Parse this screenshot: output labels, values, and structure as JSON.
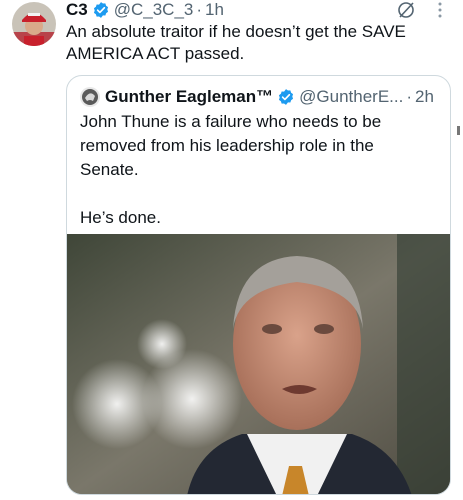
{
  "tweet": {
    "author_name": "C3",
    "handle": "@C_3C_3",
    "separator": "·",
    "time": "1h",
    "text": "An absolute traitor if he doesn’t get the SAVE AMERICA ACT passed.",
    "verified": true
  },
  "quoted_tweet": {
    "author_name": "Gunther Eagleman™",
    "handle": "@GuntherE...",
    "separator": "·",
    "time": "2h",
    "text": "John Thune is a failure who needs to be removed from his leadership role in the Senate.\n\nHe’s done.",
    "verified": true,
    "has_photo": true
  },
  "colors": {
    "verified_badge": "#1d9bf0",
    "secondary_text": "#536471",
    "border": "#cfd9de"
  },
  "icons": [
    "verified-icon",
    "grok-icon",
    "more-icon"
  ]
}
